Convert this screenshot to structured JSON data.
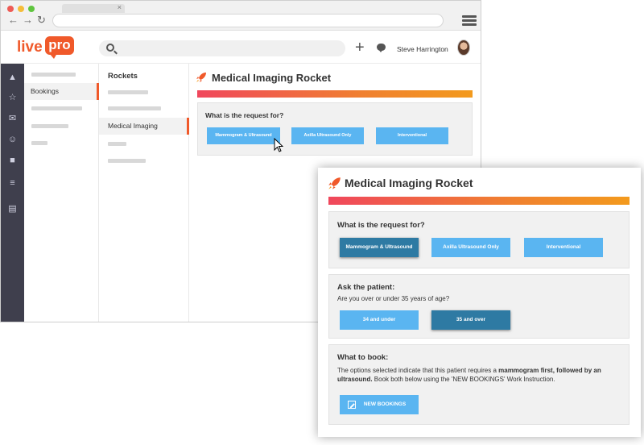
{
  "app": {
    "logo_live": "live",
    "logo_pro": "pro",
    "user_name": "Steve  Harrington"
  },
  "browser": {
    "tab_close": "×",
    "back": "←",
    "forward": "→",
    "reload": "↻"
  },
  "col1": {
    "selected_label": "Bookings"
  },
  "col2": {
    "title": "Rockets",
    "selected_label": "Medical Imaging"
  },
  "main": {
    "title": "Medical Imaging Rocket",
    "question": "What is the request for?",
    "buttons": [
      "Mammogram & Ultrasound",
      "Axilla Ultrasound Only",
      "Interventional"
    ]
  },
  "card": {
    "title": "Medical Imaging Rocket",
    "question": "What is the request for?",
    "buttons": [
      "Mammogram & Ultrasound",
      "Axilla Ultrasound Only",
      "Interventional"
    ],
    "ask_label": "Ask the patient:",
    "ask_question": "Are you over or under 35 years of age?",
    "age_buttons": [
      "34 and under",
      "35 and over"
    ],
    "book_label": "What to book:",
    "book_text_1": "The options selected indicate that this patient requires a ",
    "book_text_bold": "mammogram first, followed by an ultrasound.",
    "book_text_2": " Book both below using the 'NEW BOOKINGS' Work Instruction.",
    "new_bookings": "NEW BOOKINGS"
  },
  "colors": {
    "brand": "#f0592a",
    "button_light": "#5ab5f1",
    "button_selected": "#2e7aa3",
    "nav_dark": "#3f3f4d"
  }
}
